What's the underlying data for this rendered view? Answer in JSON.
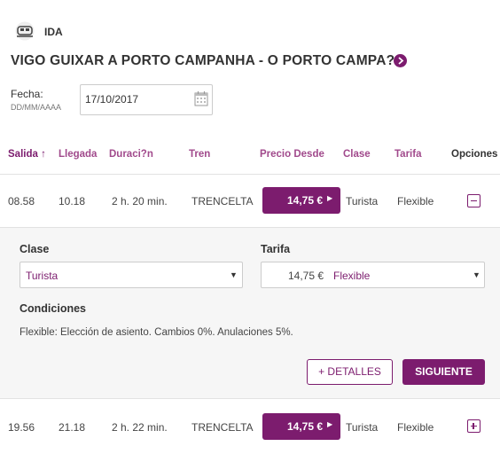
{
  "header": {
    "train_icon": "train-icon",
    "direction": "IDA",
    "route": "VIGO GUIXAR A PORTO CAMPANHA - O PORTO CAMPA?A",
    "route_icon": "chevron-right-circle-icon"
  },
  "date": {
    "label": "Fecha:",
    "format": "DD/MM/AAAA",
    "value": "17/10/2017",
    "icon": "calendar-icon"
  },
  "table": {
    "columns": {
      "salida": "Salida",
      "sort_icon": "↑",
      "llegada": "Llegada",
      "duracion": "Duraci?n",
      "tren": "Tren",
      "precio": "Precio Desde",
      "clase": "Clase",
      "tarifa": "Tarifa",
      "opciones": "Opciones"
    },
    "rows": [
      {
        "salida": "08.58",
        "llegada": "10.18",
        "duracion": "2 h. 20 min.",
        "tren": "TRENCELTA",
        "precio": "14,75 €",
        "clase": "Turista",
        "tarifa": "Flexible",
        "toggle": "collapse-icon"
      },
      {
        "salida": "19.56",
        "llegada": "21.18",
        "duracion": "2 h. 22 min.",
        "tren": "TRENCELTA",
        "precio": "14,75 €",
        "clase": "Turista",
        "tarifa": "Flexible",
        "toggle": "expand-icon"
      }
    ]
  },
  "details": {
    "clase_label": "Clase",
    "clase_value": "Turista",
    "tarifa_label": "Tarifa",
    "tarifa_price": "14,75 €",
    "tarifa_value": "Flexible",
    "condiciones_label": "Condiciones",
    "condiciones_text": "Flexible:   Elección de asiento.  Cambios 0%.  Anulaciones 5%.",
    "detalles_button": "+ DETALLES",
    "siguiente_button": "SIGUIENTE"
  },
  "colors": {
    "accent": "#7c1c6e",
    "header_text": "#a14a8c",
    "panel_bg": "#f6f6f6"
  }
}
